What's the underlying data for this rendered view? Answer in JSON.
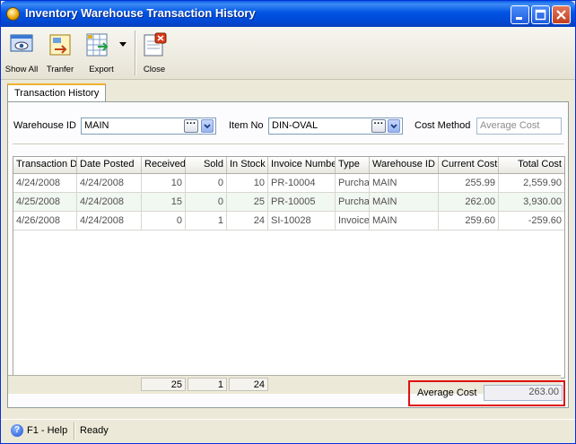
{
  "window": {
    "title": "Inventory Warehouse Transaction History"
  },
  "toolbar": {
    "show_all": "Show All",
    "transfer": "Tranfer",
    "export": "Export",
    "close": "Close"
  },
  "tab": {
    "label": "Transaction History"
  },
  "filters": {
    "warehouse_label": "Warehouse ID",
    "warehouse_value": "MAIN",
    "item_label": "Item No",
    "item_value": "DIN-OVAL",
    "cost_method_label": "Cost Method",
    "cost_method_value": "Average Cost"
  },
  "grid": {
    "columns": [
      "Transaction D",
      "Date Posted",
      "Received",
      "Sold",
      "In Stock",
      "Invoice Numbe",
      "Type",
      "Warehouse ID",
      "Current Cost",
      "Total Cost"
    ],
    "rows": [
      [
        "4/24/2008",
        "4/24/2008",
        "10",
        "0",
        "10",
        "PR-10004",
        "Purcha",
        "MAIN",
        "255.99",
        "2,559.90"
      ],
      [
        "4/25/2008",
        "4/24/2008",
        "15",
        "0",
        "25",
        "PR-10005",
        "Purcha",
        "MAIN",
        "262.00",
        "3,930.00"
      ],
      [
        "4/26/2008",
        "4/24/2008",
        "0",
        "1",
        "24",
        "SI-10028",
        "Invoice",
        "MAIN",
        "259.60",
        "-259.60"
      ]
    ],
    "totals": {
      "received": "25",
      "sold": "1",
      "in_stock": "24"
    }
  },
  "summary": {
    "avg_cost_label": "Average Cost",
    "avg_cost_value": "263.00"
  },
  "status": {
    "help": "F1 - Help",
    "state": "Ready"
  }
}
